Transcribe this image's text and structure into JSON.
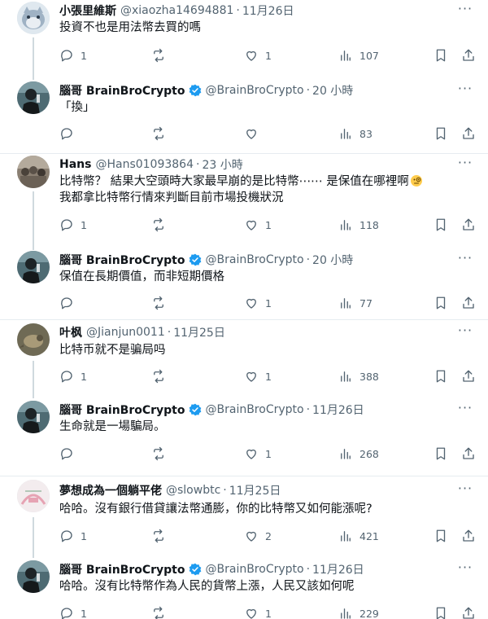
{
  "colors": {
    "text": "#0f1419",
    "muted": "#536471",
    "verified": "#1d9bf0",
    "line": "#cfd9de"
  },
  "tweets": [
    {
      "name": "小張里維斯",
      "handle": "@xiaozha14694881",
      "time": "11月26日",
      "verified": false,
      "lines": [
        "投資不也是用法幣去買的嗎"
      ],
      "reply": "1",
      "retweet": "",
      "like": "1",
      "views": "107"
    },
    {
      "name": "腦哥 BrainBroCrypto",
      "handle": "@BrainBroCrypto",
      "time": "20 小時",
      "verified": true,
      "lines": [
        "「換」"
      ],
      "reply": "",
      "retweet": "",
      "like": "",
      "views": "83"
    },
    {
      "name": "Hans",
      "handle": "@Hans01093864",
      "time": "23 小時",
      "verified": false,
      "lines": [
        "比特幣？ 結果大空頭時大家最早崩的是比特幣⋯⋯ 是保值在哪裡啊",
        "我都拿比特幣行情來判斷目前市場投機狀況"
      ],
      "emoji": "face-with-monocle",
      "reply": "1",
      "retweet": "",
      "like": "1",
      "views": "118"
    },
    {
      "name": "腦哥 BrainBroCrypto",
      "handle": "@BrainBroCrypto",
      "time": "20 小時",
      "verified": true,
      "lines": [
        "保值在長期價值，而非短期價格"
      ],
      "reply": "",
      "retweet": "",
      "like": "1",
      "views": "77"
    },
    {
      "name": "叶枫",
      "handle": "@Jianjun0011",
      "time": "11月25日",
      "verified": false,
      "lines": [
        "比特币就不是骗局吗"
      ],
      "reply": "1",
      "retweet": "",
      "like": "1",
      "views": "388"
    },
    {
      "name": "腦哥 BrainBroCrypto",
      "handle": "@BrainBroCrypto",
      "time": "11月26日",
      "verified": true,
      "lines": [
        "生命就是一場騙局。"
      ],
      "reply": "",
      "retweet": "",
      "like": "1",
      "views": "268"
    },
    {
      "name": "夢想成為一個躺平佬",
      "handle": "@slowbtc",
      "time": "11月25日",
      "verified": false,
      "lines": [
        "哈哈。沒有銀行借貸讓法幣通膨，你的比特幣又如何能漲呢?"
      ],
      "reply": "1",
      "retweet": "",
      "like": "2",
      "views": "421"
    },
    {
      "name": "腦哥 BrainBroCrypto",
      "handle": "@BrainBroCrypto",
      "time": "11月26日",
      "verified": true,
      "lines": [
        "哈哈。沒有比特幣作為人民的貨幣上漲，人民又該如何呢"
      ],
      "reply": "1",
      "retweet": "",
      "like": "1",
      "views": "229"
    }
  ]
}
